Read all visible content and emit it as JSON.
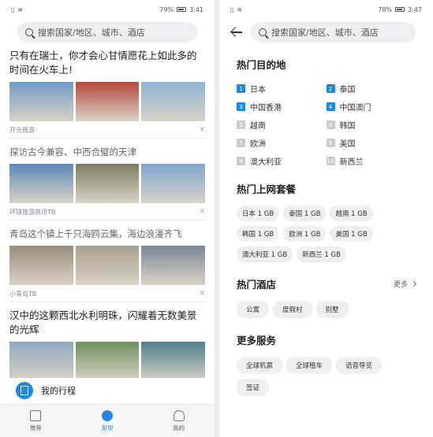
{
  "left": {
    "status": {
      "battery": "79%",
      "time": "3:41"
    },
    "search_placeholder": "搜索国家/地区、城市、酒店",
    "feed": [
      {
        "title": "只有在瑞士，你才会心甘情愿花上如此多的时间在火车上!",
        "source": "开元周游",
        "colors": [
          "#6f9bc7",
          "#b54a3a",
          "#8fb3d6"
        ]
      },
      {
        "title": "探访古今兼容、中西合璧的天津",
        "source": "环球旅游资讯TB",
        "colors": [
          "#5d89b8",
          "#7d7a64",
          "#7fa7cf"
        ]
      },
      {
        "title": "青岛这个镇上千只海鸥云集，海边浪漫齐飞",
        "source": "小青岛TB",
        "colors": [
          "#9a8d7d",
          "#a89f8f",
          "#7b8898"
        ]
      },
      {
        "title": "汉中的这颗西北水利明珠，闪耀着无数美景的光辉",
        "source": "",
        "colors": [
          "#8fa8c0",
          "#6f8f5e",
          "#4f7f8a"
        ]
      }
    ],
    "trip_label": "我的行程",
    "tabs": [
      {
        "label": "推荐"
      },
      {
        "label": "发现"
      },
      {
        "label": "我的"
      }
    ]
  },
  "right": {
    "status": {
      "battery": "78%",
      "time": "3:47"
    },
    "search_placeholder": "搜索国家/地区、城市、酒店",
    "hot_dest_title": "热门目的地",
    "destinations": [
      {
        "rank": "1",
        "name": "日本"
      },
      {
        "rank": "2",
        "name": "泰国"
      },
      {
        "rank": "3",
        "name": "中国香港"
      },
      {
        "rank": "4",
        "name": "中国澳门"
      },
      {
        "rank": "5",
        "name": "越南"
      },
      {
        "rank": "6",
        "name": "韩国"
      },
      {
        "rank": "7",
        "name": "欧洲"
      },
      {
        "rank": "8",
        "name": "美国"
      },
      {
        "rank": "9",
        "name": "澳大利亚"
      },
      {
        "rank": "10",
        "name": "新西兰"
      }
    ],
    "data_title": "热门上网套餐",
    "data_plans": [
      "日本 1 GB",
      "泰国 1 GB",
      "越南 1 GB",
      "韩国 1 GB",
      "欧洲 1 GB",
      "美国 1 GB",
      "澳大利亚 1 GB",
      "新西兰 1 GB"
    ],
    "hotel_title": "热门酒店",
    "hotel_more": "更多",
    "hotels": [
      "公寓",
      "度假村",
      "别墅"
    ],
    "services_title": "更多服务",
    "services": [
      "全球机票",
      "全球租车",
      "语音导览",
      "签证"
    ]
  },
  "accent_color": "#1e88e5"
}
